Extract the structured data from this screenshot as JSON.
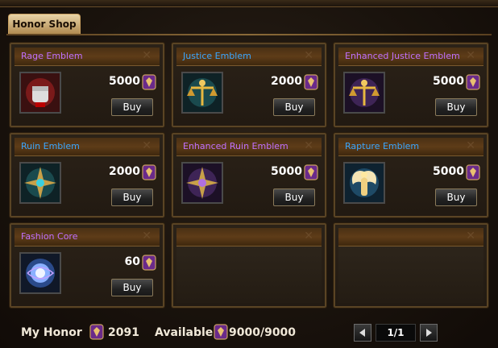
{
  "tab": {
    "label": "Honor Shop"
  },
  "colors": {
    "name_purple": "#c070ff",
    "name_blue": "#3aa6ff",
    "panel_border": "#5a4424",
    "text_white": "#ffffff"
  },
  "items": [
    {
      "name": "Rage Emblem",
      "price": "5000",
      "buy": "Buy",
      "name_color": "#c070ff",
      "icon": "fist-emblem-icon"
    },
    {
      "name": "Justice Emblem",
      "price": "2000",
      "buy": "Buy",
      "name_color": "#3aa6ff",
      "icon": "scales-emblem-icon"
    },
    {
      "name": "Enhanced Justice Emblem",
      "price": "5000",
      "buy": "Buy",
      "name_color": "#c070ff",
      "icon": "scales-emblem-purple-icon"
    },
    {
      "name": "Ruin Emblem",
      "price": "2000",
      "buy": "Buy",
      "name_color": "#3aa6ff",
      "icon": "cross-emblem-icon"
    },
    {
      "name": "Enhanced Ruin Emblem",
      "price": "5000",
      "buy": "Buy",
      "name_color": "#c070ff",
      "icon": "cross-emblem-purple-icon"
    },
    {
      "name": "Rapture Emblem",
      "price": "5000",
      "buy": "Buy",
      "name_color": "#3aa6ff",
      "icon": "angel-emblem-icon"
    },
    {
      "name": "Fashion Core",
      "price": "60",
      "buy": "Buy",
      "name_color": "#c070ff",
      "icon": "orb-core-icon"
    }
  ],
  "footer": {
    "my_honor_label": "My Honor",
    "my_honor_value": "2091",
    "available_label": "Available",
    "available_value": "9000/9000",
    "page": "1/1"
  }
}
